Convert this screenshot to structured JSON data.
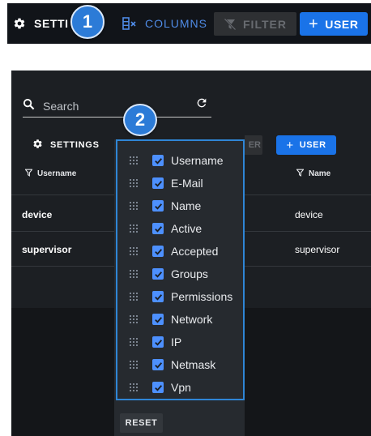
{
  "toolbar": {
    "settings_label": "SETTI",
    "columns_label": "COLUMNS",
    "filter_label": "FILTER",
    "user_label": "USER",
    "plus": "+"
  },
  "callouts": [
    "1",
    "2"
  ],
  "panel": {
    "search_placeholder": "Search",
    "settings_label": "SETTINGS",
    "filter_fragment": "ER",
    "user_label": "USER",
    "plus": "+",
    "headers": {
      "left": "Username",
      "right": "Name"
    },
    "rows": [
      {
        "username": "device",
        "name": "device"
      },
      {
        "username": "supervisor",
        "name": "supervisor"
      }
    ]
  },
  "columns_menu": {
    "items": [
      "Username",
      "E-Mail",
      "Name",
      "Active",
      "Accepted",
      "Groups",
      "Permissions",
      "Network",
      "IP",
      "Netmask",
      "Vpn"
    ],
    "checked": [
      true,
      true,
      true,
      true,
      true,
      true,
      true,
      true,
      true,
      true,
      true
    ],
    "reset_label": "RESET"
  },
  "colors": {
    "accent_blue": "#1a73e8",
    "highlight_border": "#2f86d6",
    "checkbox": "#4d90fe",
    "background_dark": "#1c1f23"
  },
  "icons": [
    "gear-icon",
    "columns-icon",
    "filter-off-icon",
    "search-icon",
    "refresh-icon",
    "filter-icon",
    "drag-handle-icon",
    "checkbox-checked-icon"
  ]
}
